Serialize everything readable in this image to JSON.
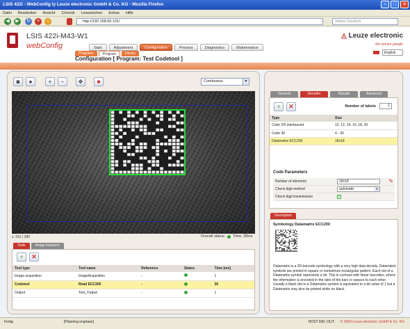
{
  "window": {
    "title": "LSIS 422i - WebConfig ly Leuze electronic GmbH & Co. KG - Mozilla Firefox"
  },
  "menu": [
    "Datei",
    "Bearbeiten",
    "Ansicht",
    "Chronik",
    "Lesezeichen",
    "Extras",
    "Hilfe"
  ],
  "browser": {
    "url": "http://192.168.60.101/",
    "search_placeholder": "Yahoo Deutsch"
  },
  "header": {
    "device_title": "LSIS 422i-M43-W1",
    "webconfig": "webConfig",
    "brand": "Leuze electronic",
    "service_link": "the sensor people",
    "language": "English"
  },
  "main_tabs": [
    "Start",
    "Adjustment",
    "Configuration",
    "Process",
    "Diagnostics",
    "Maintenance"
  ],
  "sub_tabs": [
    "Programs",
    "Program",
    "Device"
  ],
  "page_title": "Configuration [ Program: Test Codetool ]",
  "camera": {
    "mode_select": "Continuous",
    "coords": "x: 231 | 280",
    "overall_status_label": "Overall status:",
    "overall_time": "Time: 28ms"
  },
  "left_tabs": [
    "Tools",
    "Image transport"
  ],
  "tool_table": {
    "headers": [
      "Tool type",
      "Tool name",
      "Reference",
      "Status",
      "Time [ms]"
    ],
    "rows": [
      {
        "type": "Image acquisition",
        "name": "ImageAcquisition",
        "ref": "-",
        "time": "1"
      },
      {
        "type": "Codetool",
        "name": "Read ECC200",
        "ref": "-",
        "time": "26"
      },
      {
        "type": "Output",
        "name": "Tool_Output",
        "ref": "-",
        "time": "1"
      }
    ]
  },
  "right_tabs": [
    "General",
    "Decoder",
    "Results",
    "Advanced"
  ],
  "decoder": {
    "label_count_label": "Number of labels",
    "label_count": "1",
    "headers": [
      "Type",
      "Size"
    ],
    "rows": [
      {
        "type": "Code 2/5 interleaved",
        "size": "10, 12, 14, 16, 18, 20"
      },
      {
        "type": "Code 39",
        "size": "4 - 30"
      },
      {
        "type": "Datamatrix ECC200",
        "size": "18x18"
      }
    ],
    "params_title": "Code Parameters",
    "params": [
      {
        "label": "Number of elements",
        "value": "18x18"
      },
      {
        "label": "Check digit method",
        "value": "automatic"
      },
      {
        "label": "Check digit transmission",
        "value": ""
      }
    ]
  },
  "description": {
    "tab": "Description",
    "title": "Symbology Datamatrix ECC200",
    "text": "Datamatrix is a 2D barcode symbology with a very high data density. Datamatrix symbols are printed in square or sometimes rectangular pattern. Each dot of a Datamatrix symbol represents a bit. This in contrast with linear barcodes, where the information is encoded in the ratio of the bars or spaces to each other. Usually a black dot in a Datamatrix symbol is equivalent to a bit value of 1 but a Datamatrix may also be printed white on black."
  },
  "statusbar": {
    "left": "Fertig",
    "mid": "[Planning engineer]",
    "host": "HOST IND: OUT:",
    "copyright": "© 2009 Leuze electronic GmbH & Co. KG"
  },
  "colors": {
    "accent": "#c8362c",
    "tab_orange": "#e8773a",
    "status_green": "#3da43d",
    "highlight": "#fbf3a2"
  }
}
